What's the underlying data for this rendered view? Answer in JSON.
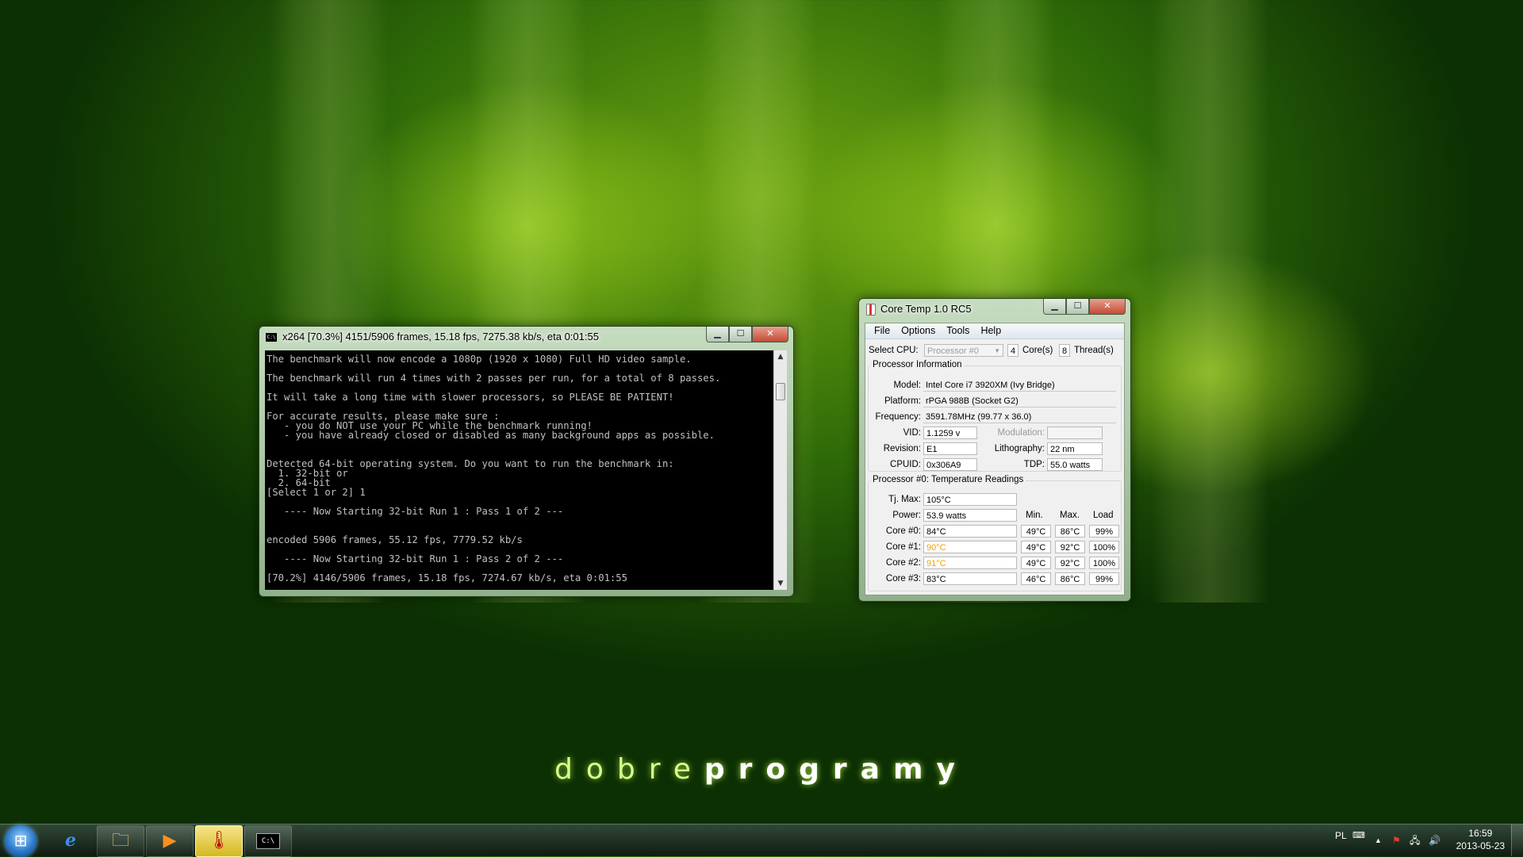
{
  "wallpaper": {
    "brand_light": "dobre",
    "brand_bold": "programy",
    "accent": "#9fd32a"
  },
  "console": {
    "icon_text": "C:\\",
    "title": "x264 [70.3%] 4151/5906 frames, 15.18 fps, 7275.38 kb/s, eta 0:01:55",
    "lines": [
      "The benchmark will now encode a 1080p (1920 x 1080) Full HD video sample.",
      "",
      "The benchmark will run 4 times with 2 passes per run, for a total of 8 passes.",
      "",
      "It will take a long time with slower processors, so PLEASE BE PATIENT!",
      "",
      "For accurate results, please make sure :",
      "   - you do NOT use your PC while the benchmark running!",
      "   - you have already closed or disabled as many background apps as possible.",
      "",
      "",
      "Detected 64-bit operating system. Do you want to run the benchmark in:",
      "  1. 32-bit or",
      "  2. 64-bit",
      "[Select 1 or 2] 1",
      "",
      "   ---- Now Starting 32-bit Run 1 : Pass 1 of 2 ---",
      "",
      "",
      "encoded 5906 frames, 55.12 fps, 7779.52 kb/s",
      "",
      "   ---- Now Starting 32-bit Run 1 : Pass 2 of 2 ---",
      "",
      "[70.2%] 4146/5906 frames, 15.18 fps, 7274.67 kb/s, eta 0:01:55"
    ]
  },
  "coretemp": {
    "title": "Core Temp 1.0 RC5",
    "menu": [
      "File",
      "Options",
      "Tools",
      "Help"
    ],
    "select_cpu_label": "Select CPU:",
    "select_cpu_value": "Processor #0",
    "cores_value": "4",
    "cores_label": "Core(s)",
    "threads_value": "8",
    "threads_label": "Thread(s)",
    "proc_info_title": "Processor Information",
    "model_label": "Model:",
    "model": "Intel Core i7 3920XM (Ivy Bridge)",
    "platform_label": "Platform:",
    "platform": "rPGA 988B (Socket G2)",
    "frequency_label": "Frequency:",
    "frequency": "3591.78MHz (99.77 x 36.0)",
    "vid_label": "VID:",
    "vid": "1.1259 v",
    "modulation_label": "Modulation:",
    "modulation": "",
    "revision_label": "Revision:",
    "revision": "E1",
    "lithography_label": "Lithography:",
    "lithography": "22 nm",
    "cpuid_label": "CPUID:",
    "cpuid": "0x306A9",
    "tdp_label": "TDP:",
    "tdp": "55.0 watts",
    "temp_title": "Processor #0: Temperature Readings",
    "tjmax_label": "Tj. Max:",
    "tjmax": "105°C",
    "power_label": "Power:",
    "power": "53.9 watts",
    "col_min": "Min.",
    "col_max": "Max.",
    "col_load": "Load",
    "hot_color": "#f0a000",
    "cores": [
      {
        "label": "Core #0:",
        "temp": "84°C",
        "min": "49°C",
        "max": "86°C",
        "load": "99%",
        "hot": false
      },
      {
        "label": "Core #1:",
        "temp": "90°C",
        "min": "49°C",
        "max": "92°C",
        "load": "100%",
        "hot": true
      },
      {
        "label": "Core #2:",
        "temp": "91°C",
        "min": "49°C",
        "max": "92°C",
        "load": "100%",
        "hot": true
      },
      {
        "label": "Core #3:",
        "temp": "83°C",
        "min": "46°C",
        "max": "86°C",
        "load": "99%",
        "hot": false
      }
    ]
  },
  "taskbar": {
    "items": [
      {
        "name": "internet-explorer-icon",
        "glyph": "e"
      },
      {
        "name": "file-explorer-icon",
        "glyph": "🗀"
      },
      {
        "name": "media-player-icon",
        "glyph": "▶"
      },
      {
        "name": "coretemp-app-icon",
        "glyph": "🌡"
      },
      {
        "name": "command-prompt-icon",
        "glyph": "C:\\"
      }
    ],
    "language": "PL",
    "time": "16:59",
    "date": "2013-05-23"
  }
}
